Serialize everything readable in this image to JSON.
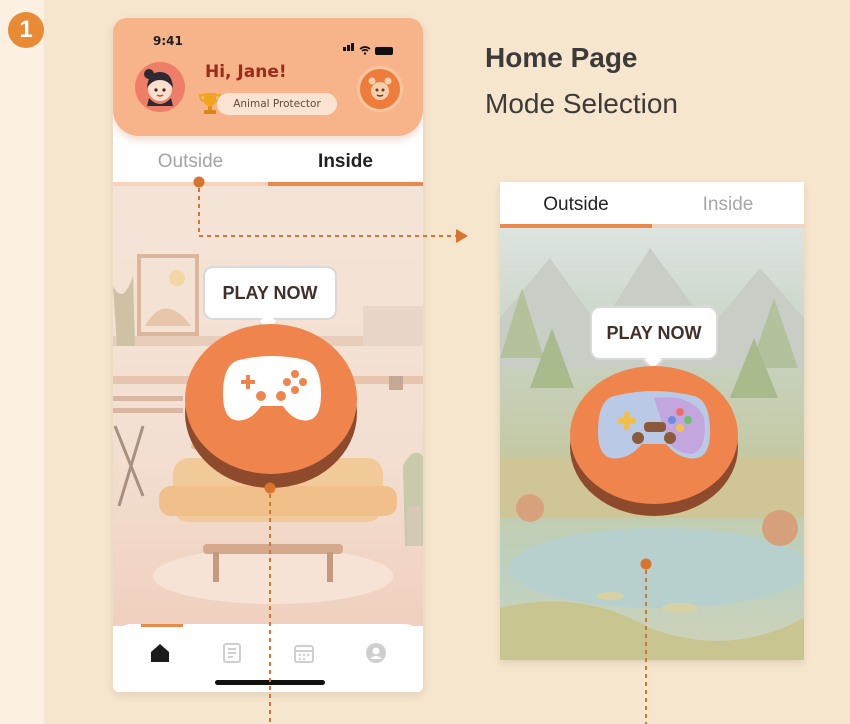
{
  "step": {
    "number": "1"
  },
  "section": {
    "title": "Home Page",
    "subtitle": "Mode Selection"
  },
  "phone": {
    "status": {
      "time": "9:41"
    },
    "greeting": "Hi, Jane!",
    "user_title": "Animal Protector",
    "tabs": [
      "Outside",
      "Inside"
    ],
    "active_tab": "Inside",
    "play_label": "PLAY NOW",
    "nav_items": [
      "home-icon",
      "journal-icon",
      "calendar-icon",
      "profile-icon"
    ],
    "active_nav": "home-icon"
  },
  "preview": {
    "tabs": [
      "Outside",
      "Inside"
    ],
    "active_tab": "Outside",
    "play_label": "PLAY NOW"
  },
  "colors": {
    "accent": "#e98a4c",
    "header": "#f7b389",
    "button": "#ef844d",
    "background": "#f7e6ce"
  }
}
